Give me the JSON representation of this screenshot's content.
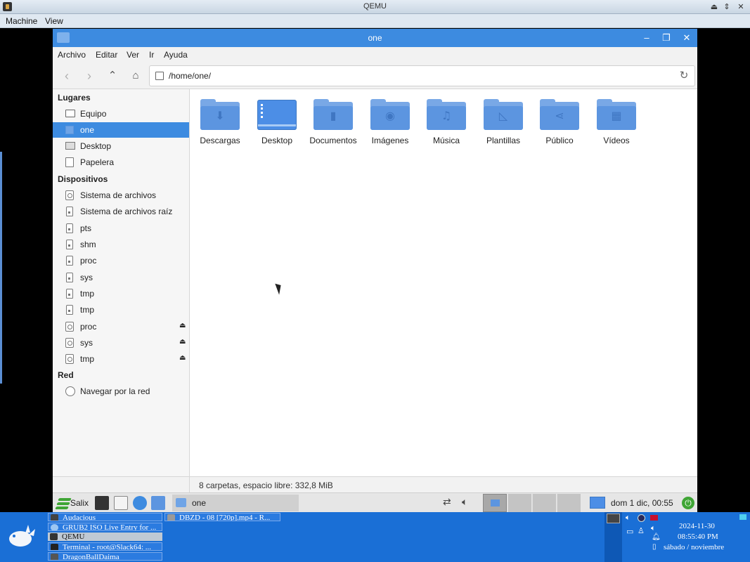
{
  "qemu": {
    "title": "QEMU",
    "menu": [
      "Machine",
      "View"
    ]
  },
  "window": {
    "title": "one",
    "menu": [
      "Archivo",
      "Editar",
      "Ver",
      "Ir",
      "Ayuda"
    ],
    "controls": [
      "minimize-icon",
      "maximize-icon",
      "close-icon"
    ]
  },
  "location": {
    "path": "/home/one/"
  },
  "sidebar": {
    "sections": [
      {
        "heading": "Lugares",
        "items": [
          {
            "label": "Equipo",
            "icon": "computer-icon"
          },
          {
            "label": "one",
            "icon": "home-folder-icon",
            "selected": true
          },
          {
            "label": "Desktop",
            "icon": "desktop-icon"
          },
          {
            "label": "Papelera",
            "icon": "trash-icon"
          }
        ]
      },
      {
        "heading": "Dispositivos",
        "items": [
          {
            "label": "Sistema de archivos",
            "icon": "drive-icon"
          },
          {
            "label": "Sistema de archivos raíz",
            "icon": "usb-drive-icon"
          },
          {
            "label": "pts",
            "icon": "usb-drive-icon"
          },
          {
            "label": "shm",
            "icon": "usb-drive-icon"
          },
          {
            "label": "proc",
            "icon": "usb-drive-icon"
          },
          {
            "label": "sys",
            "icon": "usb-drive-icon"
          },
          {
            "label": "tmp",
            "icon": "usb-drive-icon"
          },
          {
            "label": "tmp",
            "icon": "usb-drive-icon"
          },
          {
            "label": "proc",
            "icon": "drive-icon",
            "eject": true
          },
          {
            "label": "sys",
            "icon": "drive-icon",
            "eject": true
          },
          {
            "label": "tmp",
            "icon": "drive-icon",
            "eject": true
          }
        ]
      },
      {
        "heading": "Red",
        "items": [
          {
            "label": "Navegar por la red",
            "icon": "network-icon"
          }
        ]
      }
    ]
  },
  "folders": [
    {
      "name": "Descargas",
      "glyph": "download-icon",
      "symbol": "⬇"
    },
    {
      "name": "Desktop",
      "glyph": "desktop-icon",
      "symbol": ""
    },
    {
      "name": "Documentos",
      "glyph": "document-icon",
      "symbol": "▮"
    },
    {
      "name": "Imágenes",
      "glyph": "camera-icon",
      "symbol": "◉"
    },
    {
      "name": "Música",
      "glyph": "music-icon",
      "symbol": "♫"
    },
    {
      "name": "Plantillas",
      "glyph": "template-icon",
      "symbol": "◺"
    },
    {
      "name": "Público",
      "glyph": "share-icon",
      "symbol": "⋖"
    },
    {
      "name": "Vídeos",
      "glyph": "film-icon",
      "symbol": "▦"
    }
  ],
  "status": {
    "text": "8 carpetas, espacio libre: 332,8 MiB"
  },
  "guest_panel": {
    "menu_label": "Salix",
    "task_label": "one",
    "clock": "dom  1 dic, 00:55"
  },
  "host_taskbar": {
    "tasks": [
      {
        "label": "Audacious",
        "color": "#444444"
      },
      {
        "label": "GRUB2 ISO Live Entry for ...",
        "color": "#4a90e2"
      },
      {
        "label": "QEMU",
        "color": "#333333",
        "active": true
      },
      {
        "label": "Terminal - root@Slack64: ...",
        "color": "#222222"
      },
      {
        "label": "DragonBallDaima",
        "color": "#555555"
      },
      {
        "label": "DBZD - 08 [720p].mp4 - R...",
        "color": "#888888"
      }
    ],
    "clock_date": "2024-11-30",
    "clock_time": "08:55:40 PM",
    "clock_day": "sábado / noviembre"
  },
  "colors": {
    "accent": "#3d8be0",
    "host_panel": "#1a6fd6",
    "salix_green": "#3fa535"
  }
}
